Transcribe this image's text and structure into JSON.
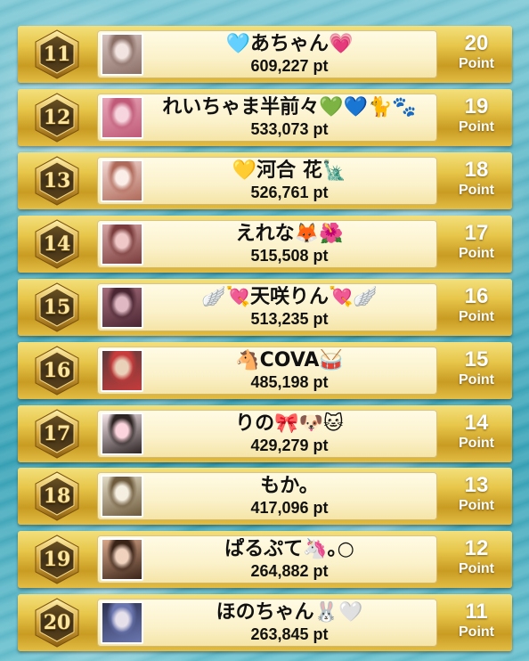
{
  "rankings": [
    {
      "rank": "11",
      "name": "🩵あちゃん💗",
      "score": "609,227 pt",
      "points": "20",
      "points_label": "Point",
      "photo_colors": [
        "#d8c4c0",
        "#8a6f66",
        "#f2e4e0"
      ]
    },
    {
      "rank": "12",
      "name": "れいちゃま半前々💚💙🐈🐾",
      "score": "533,073 pt",
      "points": "19",
      "points_label": "Point",
      "photo_colors": [
        "#e8a7b8",
        "#c05a78",
        "#f6d5de"
      ]
    },
    {
      "rank": "13",
      "name": "💛河合 花🗽",
      "score": "526,761 pt",
      "points": "18",
      "points_label": "Point",
      "photo_colors": [
        "#f3d9d4",
        "#b06a5a",
        "#fbeee9"
      ]
    },
    {
      "rank": "14",
      "name": "えれな🦊🌺",
      "score": "515,508 pt",
      "points": "17",
      "points_label": "Point",
      "photo_colors": [
        "#d7a7a6",
        "#7a3c3c",
        "#f0c8c8"
      ]
    },
    {
      "rank": "15",
      "name": "🪽💘天咲りん💘🪽",
      "score": "513,235 pt",
      "points": "16",
      "points_label": "Point",
      "photo_colors": [
        "#a66d7c",
        "#4a2632",
        "#e0b8c4"
      ]
    },
    {
      "rank": "16",
      "name": "🐴COVA🥁",
      "score": "485,198 pt",
      "points": "15",
      "points_label": "Point",
      "photo_colors": [
        "#5a3a3a",
        "#c63b3b",
        "#e9d0b8"
      ]
    },
    {
      "rank": "17",
      "name": "りの🎀🐶🐱",
      "score": "429,279 pt",
      "points": "14",
      "points_label": "Point",
      "photo_colors": [
        "#f7e6ea",
        "#2d2424",
        "#fbd4dd"
      ]
    },
    {
      "rank": "18",
      "name": "もか。",
      "score": "417,096 pt",
      "points": "13",
      "points_label": "Point",
      "photo_colors": [
        "#e3dcc6",
        "#6e5a3c",
        "#f4efe0"
      ]
    },
    {
      "rank": "19",
      "name": "ぱるぷて🦄｡○",
      "score": "264,882 pt",
      "points": "12",
      "points_label": "Point",
      "photo_colors": [
        "#d9a78a",
        "#3a2418",
        "#f1d2bf"
      ]
    },
    {
      "rank": "20",
      "name": "ほのちゃん🐰🤍",
      "score": "263,845 pt",
      "points": "11",
      "points_label": "Point",
      "photo_colors": [
        "#2b3050",
        "#6a76b0",
        "#e6e0ea"
      ]
    }
  ]
}
